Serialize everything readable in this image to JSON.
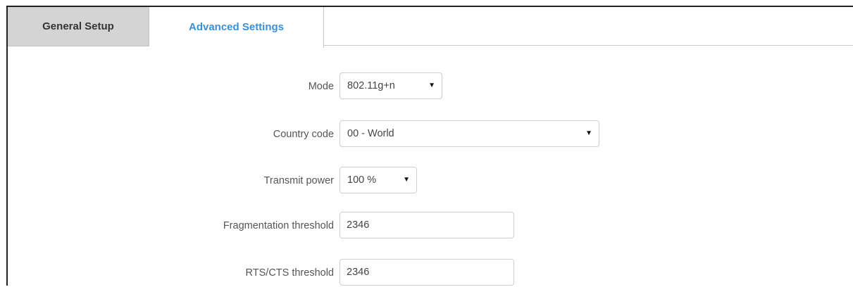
{
  "tabs": {
    "general_label": "General Setup",
    "advanced_label": "Advanced Settings",
    "active": "Advanced Settings"
  },
  "fields": {
    "mode": {
      "label": "Mode",
      "value": "802.11g+n"
    },
    "country_code": {
      "label": "Country code",
      "value": "00 - World"
    },
    "transmit_power": {
      "label": "Transmit power",
      "value": "100 %"
    },
    "fragmentation_threshold": {
      "label": "Fragmentation threshold",
      "value": "2346"
    },
    "rts_cts_threshold": {
      "label": "RTS/CTS threshold",
      "value": "2346"
    }
  },
  "icons": {
    "dropdown": "caret-down-icon"
  },
  "colors": {
    "active_tab_text": "#3a8fd9",
    "inactive_tab_bg": "#d4d4d4",
    "label_text": "#555555"
  }
}
